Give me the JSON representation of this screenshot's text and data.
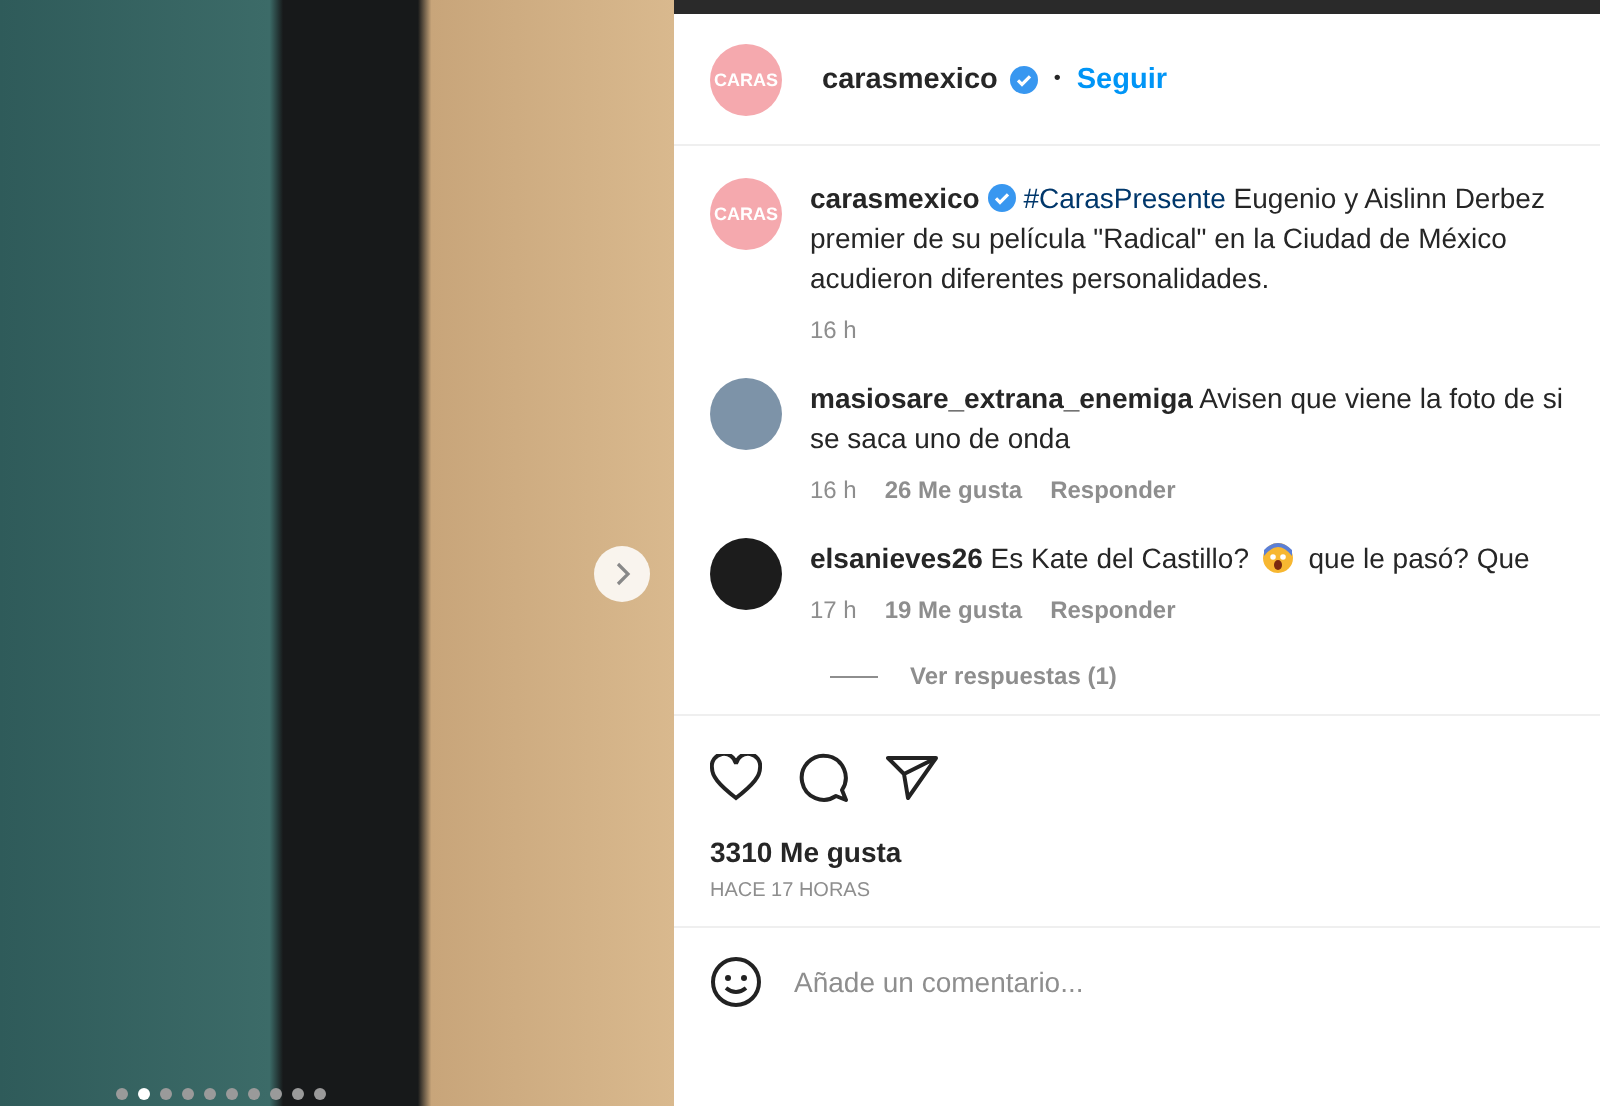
{
  "photo": {
    "dots": [
      {
        "selected": false
      },
      {
        "selected": true
      },
      {
        "selected": false
      },
      {
        "selected": false
      },
      {
        "selected": false
      },
      {
        "selected": false
      },
      {
        "selected": false
      },
      {
        "selected": false
      },
      {
        "selected": false
      },
      {
        "selected": false
      }
    ]
  },
  "header": {
    "avatar_text": "CARAS",
    "username": "carasmexico",
    "verified": true,
    "separator": "•",
    "follow": "Seguir"
  },
  "caption": {
    "avatar_text": "CARAS",
    "username": "carasmexico",
    "verified": true,
    "hashtag": "#CarasPresente",
    "text": "Eugenio y Aislinn Derbez premier de su película \"Radical\" en la Ciudad de México acudieron diferentes personalidades.",
    "time": "16 h"
  },
  "comments": [
    {
      "username": "masiosare_extrana_enemiga",
      "text": "Avisen que viene la foto de si se saca uno de onda",
      "time": "16 h",
      "likes": "26 Me gusta",
      "reply": "Responder"
    },
    {
      "username": "elsanieves26",
      "text": "Es Kate del Castillo?",
      "emoji": true,
      "text_after": "que le pasó? Que",
      "time": "17 h",
      "likes": "19 Me gusta",
      "reply": "Responder"
    }
  ],
  "view_replies": "Ver respuestas (1)",
  "likes": "3310 Me gusta",
  "posted": "HACE 17 HORAS",
  "comment_field": {
    "placeholder": "Añade un comentario..."
  }
}
